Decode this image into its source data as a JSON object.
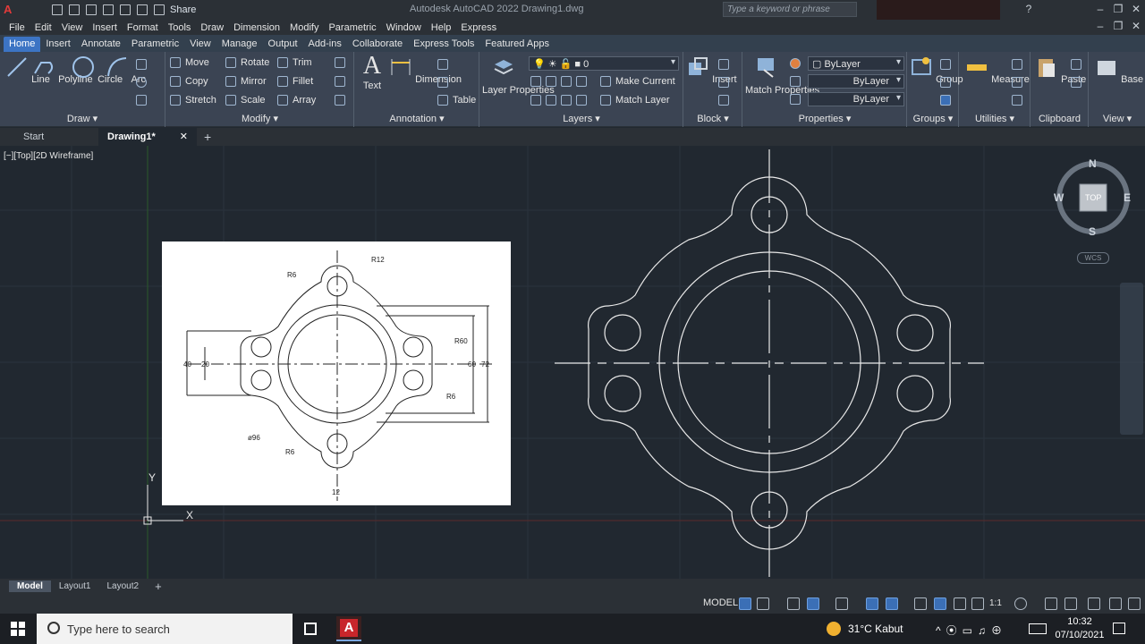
{
  "app": {
    "logo": "A",
    "title": "Autodesk AutoCAD 2022    Drawing1.dwg",
    "share_label": "Share",
    "search_placeholder": "Type a keyword or phrase"
  },
  "menu": [
    "File",
    "Edit",
    "View",
    "Insert",
    "Format",
    "Tools",
    "Draw",
    "Dimension",
    "Modify",
    "Parametric",
    "Window",
    "Help",
    "Express"
  ],
  "ribbon_tabs": [
    "Home",
    "Insert",
    "Annotate",
    "Parametric",
    "View",
    "Manage",
    "Output",
    "Add-ins",
    "Collaborate",
    "Express Tools",
    "Featured Apps"
  ],
  "active_ribbon_tab": "Home",
  "draw": {
    "title": "Draw",
    "tools": [
      "Line",
      "Polyline",
      "Circle",
      "Arc"
    ]
  },
  "modify": {
    "title": "Modify",
    "items": [
      "Move",
      "Rotate",
      "Trim",
      "Copy",
      "Mirror",
      "Fillet",
      "Stretch",
      "Scale",
      "Array"
    ]
  },
  "annotation": {
    "title": "Annotation",
    "text": "Text",
    "dimension": "Dimension",
    "table": "Table"
  },
  "layers": {
    "title": "Layers",
    "layer_properties": "Layer Properties",
    "current_layer": "0",
    "make_current": "Make Current",
    "match_layer": "Match Layer"
  },
  "block": {
    "title": "Block",
    "insert": "Insert"
  },
  "properties": {
    "title": "Properties",
    "match_properties": "Match Properties",
    "color": "ByLayer",
    "linetype": "ByLayer",
    "lineweight": "ByLayer"
  },
  "groups": {
    "title": "Groups",
    "group": "Group"
  },
  "utilities": {
    "title": "Utilities",
    "measure": "Measure"
  },
  "clipboard": {
    "title": "Clipboard",
    "paste": "Paste"
  },
  "viewpanel": {
    "title": "View",
    "base": "Base"
  },
  "doc_tabs": {
    "start": "Start",
    "drawing": "Drawing1*"
  },
  "viewport_label": "[−][Top][2D Wireframe]",
  "reference": {
    "r12": "R12",
    "r6a": "R6",
    "r6b": "R6",
    "r6c": "R6",
    "r60": "R60",
    "d40": "40",
    "d20": "20",
    "d60": "60",
    "d72": "72",
    "d96": "ø96",
    "d12": "12"
  },
  "viewcube": {
    "n": "N",
    "s": "S",
    "e": "E",
    "w": "W",
    "top": "TOP",
    "wcs": "WCS"
  },
  "ucs": {
    "x": "X",
    "y": "Y"
  },
  "layout_tabs": [
    "Model",
    "Layout1",
    "Layout2"
  ],
  "status": {
    "model": "MODEL",
    "scale": "1:1"
  },
  "taskbar": {
    "search": "Type here to search",
    "weather": "31°C  Kabut",
    "time": "10:32",
    "date": "07/10/2021"
  },
  "colors": {
    "accent": "#3c74c4",
    "canvas": "#212830",
    "ribbon": "#3b4453"
  }
}
